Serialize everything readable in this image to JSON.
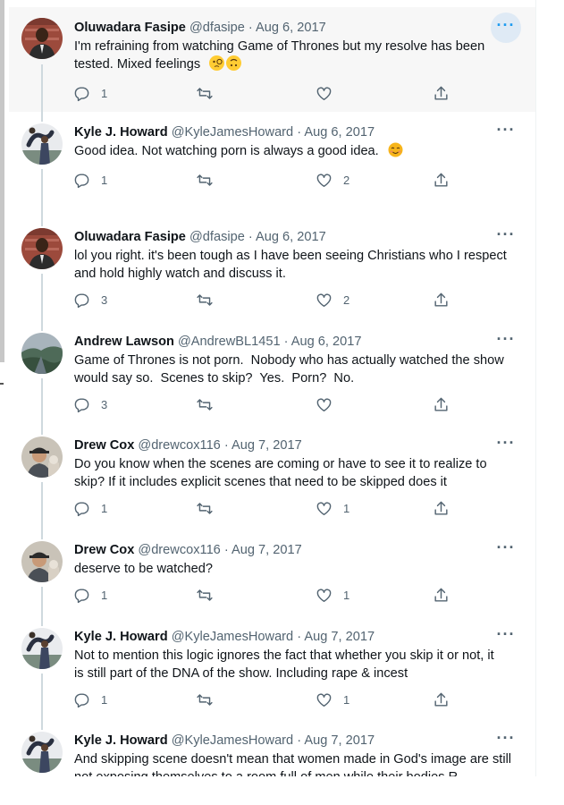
{
  "colors": {
    "accent": "#1d9bf0",
    "text": "#0f1419",
    "secondary": "#536471"
  },
  "tweets": [
    {
      "name": "Oluwadara Fasipe",
      "handle": "@dfasipe",
      "date": "Aug 6, 2017",
      "lines": [
        "I'm refraining from watching Game of Thrones but my resolve has been",
        "tested. Mixed feelings"
      ],
      "emoji": [
        "face-with-monocle-emoji",
        "upside-down-face-emoji"
      ],
      "replies": "1",
      "retweets": "",
      "likes": ""
    },
    {
      "name": "Kyle J. Howard",
      "handle": "@KyleJamesHoward",
      "date": "Aug 6, 2017",
      "lines": [
        "Good idea. Not watching porn is always a good idea."
      ],
      "emoji": [
        "smiling-face-with-smiling-eyes-emoji"
      ],
      "replies": "1",
      "retweets": "",
      "likes": "2"
    },
    {
      "name": "Oluwadara Fasipe",
      "handle": "@dfasipe",
      "date": "Aug 6, 2017",
      "lines": [
        "lol you right. it's been tough as I have been seeing Christians who I respect",
        "and hold highly watch and discuss it."
      ],
      "replies": "3",
      "retweets": "",
      "likes": "2"
    },
    {
      "name": "Andrew Lawson",
      "handle": "@AndrewBL1451",
      "date": "Aug 6, 2017",
      "lines": [
        "Game of Thrones is not porn.  Nobody who has actually watched the show",
        "would say so.  Scenes to skip?  Yes.  Porn?  No."
      ],
      "replies": "3",
      "retweets": "",
      "likes": ""
    },
    {
      "name": "Drew Cox",
      "handle": "@drewcox116",
      "date": "Aug 7, 2017",
      "lines": [
        "Do you know when the scenes are coming or have to see it to realize to",
        "skip? If it includes explicit scenes that need to be skipped does it"
      ],
      "replies": "1",
      "retweets": "",
      "likes": "1"
    },
    {
      "name": "Drew Cox",
      "handle": "@drewcox116",
      "date": "Aug 7, 2017",
      "lines": [
        "deserve to be watched?"
      ],
      "replies": "1",
      "retweets": "",
      "likes": "1"
    },
    {
      "name": "Kyle J. Howard",
      "handle": "@KyleJamesHoward",
      "date": "Aug 7, 2017",
      "lines": [
        "Not to mention this logic ignores the fact that whether you skip it or not, it",
        "is still part of the DNA of the show. Including rape & incest"
      ],
      "replies": "1",
      "retweets": "",
      "likes": "1"
    },
    {
      "name": "Kyle J. Howard",
      "handle": "@KyleJamesHoward",
      "date": "Aug 7, 2017",
      "lines": [
        "And skipping scene doesn't mean that women made in God's image are still",
        "not exposing themselves to a room full of men while their bodies R"
      ]
    }
  ],
  "icons": {
    "more": "more-icon",
    "reply": "reply-icon",
    "retweet": "retweet-icon",
    "like": "like-icon",
    "share": "share-icon"
  }
}
